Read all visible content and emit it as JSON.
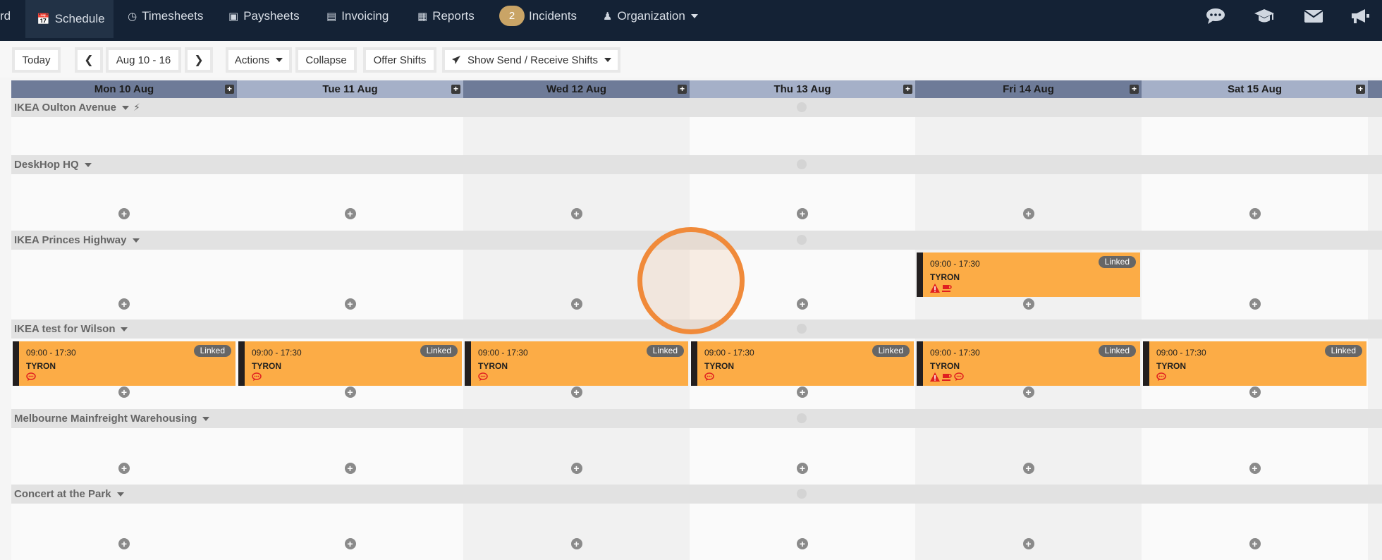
{
  "nav": {
    "partial_left": "rd",
    "items": [
      {
        "id": "schedule",
        "label": "Schedule",
        "icon": "calendar-icon",
        "active": true
      },
      {
        "id": "timesheets",
        "label": "Timesheets",
        "icon": "clock-icon"
      },
      {
        "id": "paysheets",
        "label": "Paysheets",
        "icon": "money-icon"
      },
      {
        "id": "invoicing",
        "label": "Invoicing",
        "icon": "invoice-icon"
      },
      {
        "id": "reports",
        "label": "Reports",
        "icon": "table-icon"
      }
    ],
    "incidents": {
      "count": "2",
      "label": "Incidents"
    },
    "organization": {
      "label": "Organization",
      "icon": "users-icon"
    },
    "right_icons": [
      "chat-icon",
      "graduation-cap-icon",
      "envelope-icon",
      "megaphone-icon"
    ]
  },
  "toolbar": {
    "today": "Today",
    "range": "Aug 10 - 16",
    "actions": "Actions",
    "collapse": "Collapse",
    "offer_shifts": "Offer Shifts",
    "send_receive": "Show Send / Receive Shifts"
  },
  "days": [
    {
      "label": "Mon 10 Aug",
      "shade": "dark",
      "col": "white"
    },
    {
      "label": "Tue 11 Aug",
      "shade": "light",
      "col": "white"
    },
    {
      "label": "Wed 12 Aug",
      "shade": "dark",
      "col": "grey"
    },
    {
      "label": "Thu 13 Aug",
      "shade": "light",
      "col": "white"
    },
    {
      "label": "Fri 14 Aug",
      "shade": "dark",
      "col": "grey"
    },
    {
      "label": "Sat 15 Aug",
      "shade": "light",
      "col": "white"
    }
  ],
  "locations": [
    {
      "name": "IKEA Oulton Avenue",
      "bolt": true
    },
    {
      "name": "DeskHop HQ"
    },
    {
      "name": "IKEA Princes Highway"
    },
    {
      "name": "IKEA test for Wilson"
    },
    {
      "name": "Melbourne Mainfreight Warehousing"
    },
    {
      "name": "Concert at the Park"
    }
  ],
  "shifts": [
    {
      "location": 2,
      "day": 4,
      "time": "09:00 - 17:30",
      "who": "TYRON",
      "badge": "Linked",
      "icons": [
        "warning-icon",
        "coffee-icon"
      ]
    },
    {
      "location": 3,
      "day": 0,
      "time": "09:00 - 17:30",
      "who": "TYRON",
      "badge": "Linked",
      "icons": [
        "comment-icon"
      ]
    },
    {
      "location": 3,
      "day": 1,
      "time": "09:00 - 17:30",
      "who": "TYRON",
      "badge": "Linked",
      "icons": [
        "comment-icon"
      ]
    },
    {
      "location": 3,
      "day": 2,
      "time": "09:00 - 17:30",
      "who": "TYRON",
      "badge": "Linked",
      "icons": [
        "comment-icon"
      ]
    },
    {
      "location": 3,
      "day": 3,
      "time": "09:00 - 17:30",
      "who": "TYRON",
      "badge": "Linked",
      "icons": [
        "comment-icon"
      ]
    },
    {
      "location": 3,
      "day": 4,
      "time": "09:00 - 17:30",
      "who": "TYRON",
      "badge": "Linked",
      "icons": [
        "warning-icon",
        "coffee-icon",
        "comment-icon"
      ]
    },
    {
      "location": 3,
      "day": 5,
      "time": "09:00 - 17:30",
      "who": "TYRON",
      "badge": "Linked",
      "icons": [
        "comment-icon"
      ]
    }
  ]
}
